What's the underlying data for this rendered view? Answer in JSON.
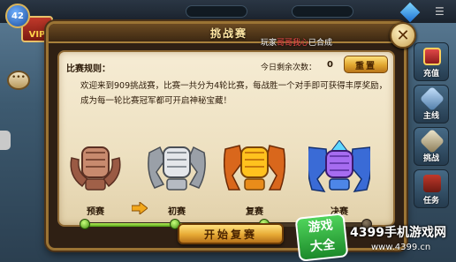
{
  "hud": {
    "level": "42",
    "vip": "VIP"
  },
  "side_menu": {
    "items": [
      {
        "label": "充值",
        "icon": "gift-icon"
      },
      {
        "label": "主线",
        "icon": "blade-icon"
      },
      {
        "label": "挑战",
        "icon": "sword-icon"
      },
      {
        "label": "任务",
        "icon": "task-icon"
      }
    ]
  },
  "dialog": {
    "title": "挑战赛",
    "notice_prefix": "玩家",
    "notice_name": "哥哥我心",
    "notice_suffix": "已合成",
    "rules_title": "比赛规则：",
    "chances_label": "今日剩余次数：",
    "chances_value": "0",
    "reset_button": "重置",
    "rules_lines": [
      "欢迎来到909挑战赛，比赛一共分为4轮比赛，每战胜一个对手即可获得丰厚奖励，",
      "成为每一轮比赛冠军都可开启神秘宝藏！"
    ],
    "stages": [
      "预赛",
      "初赛",
      "复赛",
      "决赛"
    ],
    "progress": {
      "completed_stages": 3,
      "total_stages": 4
    },
    "start_button": "开始复赛"
  },
  "watermark": {
    "logo_line1": "游戏",
    "logo_line2": "大全",
    "site_name": "4399手机游戏网",
    "url": "www.4399.cn"
  },
  "colors": {
    "bronze": "#b0705a",
    "silver": "#c6c6c6",
    "gold": "#f0a020",
    "legend": "#3a6bd6",
    "progress": "#6cc126"
  }
}
